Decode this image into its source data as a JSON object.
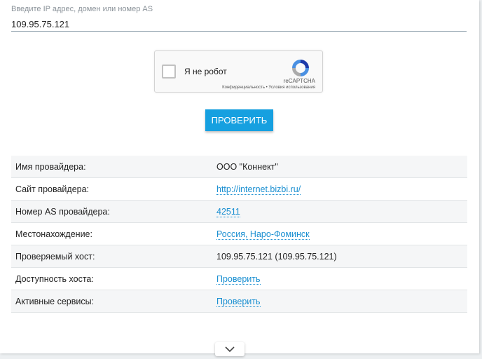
{
  "search": {
    "label": "Введите IP адрес, домен или номер AS",
    "value": "109.95.75.121"
  },
  "captcha": {
    "label": "Я не робот",
    "brand": "reCAPTCHA",
    "links": "Конфиденциальность • Условия использования"
  },
  "submit": {
    "label": "ПРОВЕРИТЬ"
  },
  "info": {
    "rows": [
      {
        "key": "Имя провайдера:",
        "value": "ООО \"Коннект\""
      },
      {
        "key": "Сайт провайдера:",
        "value": "http://internet.bizbi.ru/"
      },
      {
        "key": "Номер AS провайдера:",
        "value": "42511"
      },
      {
        "key": "Местонахождение:",
        "value": "Россия, Наро-Фоминск"
      },
      {
        "key": "Проверяемый хост:",
        "value": "109.95.75.121 (109.95.75.121)"
      },
      {
        "key": "Доступность хоста:",
        "value": "Проверить"
      },
      {
        "key": "Активные сервисы:",
        "value": "Проверить"
      }
    ]
  },
  "colors": {
    "accent": "#16a0e0",
    "link": "#1a8fd1"
  },
  "icons": {
    "captcha_logo": "recaptcha-logo-icon",
    "expand": "chevron-down-icon"
  }
}
